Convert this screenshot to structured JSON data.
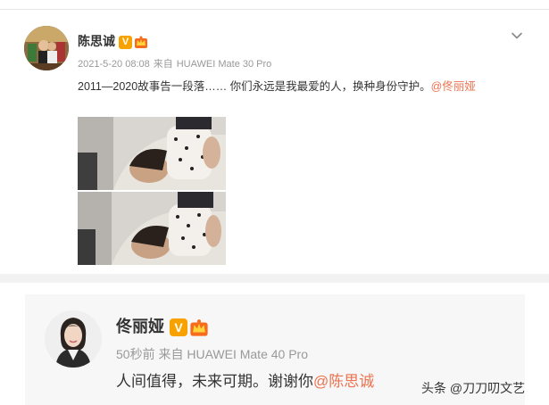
{
  "post1": {
    "author": "陈思诚",
    "timestamp": "2021-5-20 08:08",
    "source_prefix": "来自",
    "device": "HUAWEI Mate 30 Pro",
    "text": "2011—2020故事告一段落…… 你们永远是我最爱的人，换种身份守护。",
    "mention": "@佟丽娅",
    "badge_v": "V",
    "menu_icon": "chevron-down-icon"
  },
  "post2": {
    "author": "佟丽娅",
    "time_ago": "50秒前",
    "source_prefix": "来自",
    "device": "HUAWEI Mate 40 Pro",
    "text": "人间值得，未来可期。谢谢你",
    "mention": "@陈思诚",
    "badge_v": "V"
  },
  "watermark": "头条 @刀刀叨文艺",
  "colors": {
    "mention": "#eb7350",
    "badge_v": "#f7a200",
    "meta": "#999999",
    "divider": "#f2f2f2"
  }
}
